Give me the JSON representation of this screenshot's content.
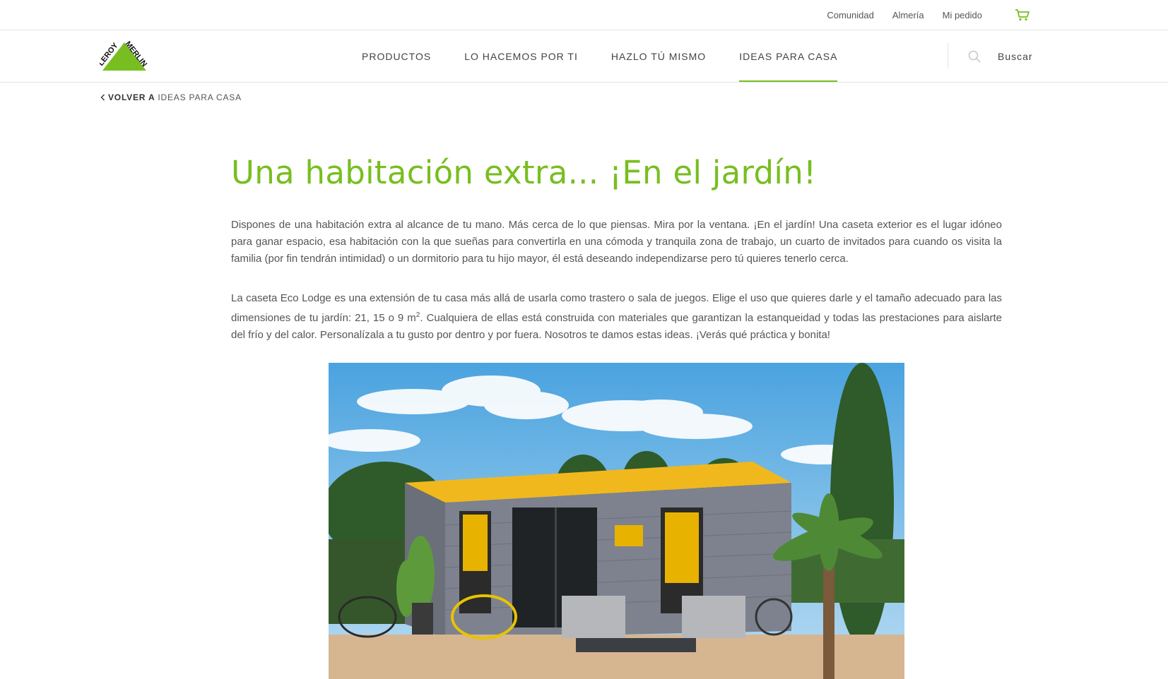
{
  "topbar": {
    "links": [
      "Comunidad",
      "Almería",
      "Mi pedido"
    ],
    "cart_icon": "cart-icon"
  },
  "header": {
    "logo_text": "LEROY MERLIN",
    "nav": [
      "PRODUCTOS",
      "LO HACEMOS POR TI",
      "HAZLO TÚ MISMO",
      "IDEAS PARA CASA"
    ],
    "active_nav": "IDEAS PARA CASA",
    "search_label": "Buscar",
    "search_icon": "search-icon"
  },
  "breadcrumb": {
    "back_label": "VOLVER A",
    "target_label": "IDEAS PARA CASA"
  },
  "article": {
    "title": "Una habitación extra... ¡En el jardín!",
    "paragraph1": "Dispones de una habitación extra al alcance de tu mano. Más cerca de lo que piensas. Mira por la ventana. ¡En el jardín! Una caseta exterior es el lugar idóneo para ganar espacio, esa habitación con la que sueñas para convertirla en una cómoda y tranquila zona de trabajo, un cuarto de invitados para cuando os visita la familia (por fin tendrán intimidad) o un dormitorio para tu hijo mayor, él está deseando independizarse pero tú quieres tenerlo cerca.",
    "paragraph2_a": "La caseta Eco Lodge es una extensión de tu casa más allá de usarla como trastero o sala de juegos. Elige el uso que quieres darle y el tamaño adecuado para las dimensiones de tu jardín: 21, 15 o 9 m",
    "paragraph2_sup": "2",
    "paragraph2_b": ". Cualquiera de ellas está construida con materiales que garantizan la estanqueidad y todas las prestaciones para aislarte del frío y del calor. Personalízala a tu gusto por dentro y por fuera. Nosotros te damos estas ideas. ¡Verás qué práctica y bonita!"
  },
  "colors": {
    "brand_green": "#78be20",
    "text": "#555555",
    "divider": "#e4e4e4"
  }
}
